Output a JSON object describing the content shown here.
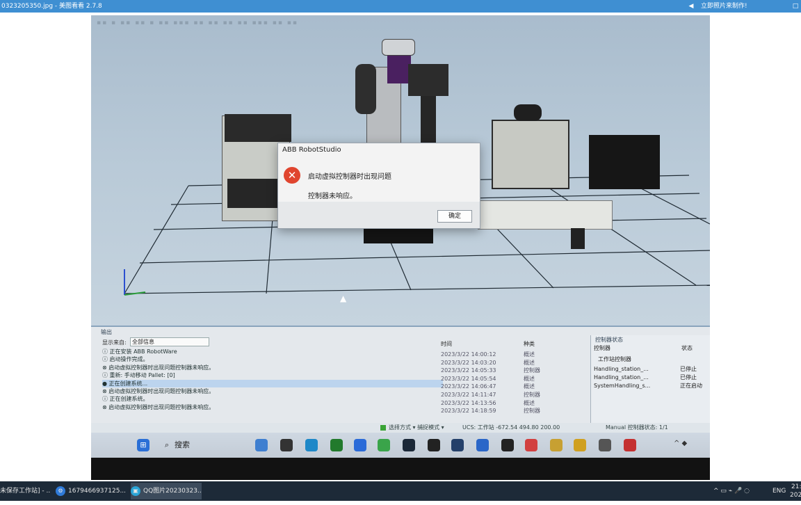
{
  "viewer": {
    "title": "0323205350.jpg - 美图看看 2.7.8",
    "speaker_icon": "speaker-icon",
    "promo": "立即照片来制作!",
    "maximize_label": "□"
  },
  "scene": {
    "toolbar_text": "▪▪ ▪ ▪▪ ▪▪ ▪ ▪▪ ▪▪▪ ▪▪ ▪▪ ▪▪ ▪▪ ▪▪▪ ▪▪ ▪▪"
  },
  "dialog": {
    "title": "ABB RobotStudio",
    "icon": "error-icon",
    "icon_glyph": "✕",
    "message": "启动虚拟控制器时出现问题",
    "detail": "控制器未响应。",
    "ok_label": "确定"
  },
  "output": {
    "tab_label": "输出",
    "filter_label": "显示来自:",
    "filter_value": "全部信息",
    "col_time": "时间",
    "col_category": "种类",
    "messages": [
      "ⓘ 正在安装 ABB RobotWare",
      "ⓘ 启动操作完成。",
      "⊗ 启动虚拟控制器时出现问题控制器未响应。",
      "ⓘ 重新: 手动移动 Pallet: [0]",
      "● 正在创建系统...",
      "⊗ 启动虚拟控制器时出现问题控制器未响应。",
      "ⓘ 正在创建系统。",
      "⊗ 启动虚拟控制器时出现问题控制器未响应。"
    ],
    "times": [
      "2023/3/22 14:00:12",
      "2023/3/22 14:03:20",
      "2023/3/22 14:05:33",
      "2023/3/22 14:05:54",
      "2023/3/22 14:06:47",
      "2023/3/22 14:11:47",
      "2023/3/22 14:13:56",
      "2023/3/22 14:18:59"
    ],
    "categories": [
      "概述",
      "概述",
      "控制器",
      "概述",
      "概述",
      "控制器",
      "概述",
      "控制器"
    ]
  },
  "controller_panel": {
    "header": "控制器状态",
    "col_controller": "控制器",
    "col_state": "状态",
    "group": "工作站控制器",
    "rows": [
      {
        "name": "Handling_station_...",
        "state": "已停止"
      },
      {
        "name": "Handling_station_...",
        "state": "已停止"
      },
      {
        "name": "SystemHandling_s...",
        "state": "正在启动"
      }
    ]
  },
  "status_bar": {
    "mode": "选择方式 ▾ 捕捉模式 ▾",
    "coords": "UCS: 工作站  -672.54  494.80  200.00",
    "right": "Manual  控制器状态: 1/1"
  },
  "photo_taskbar": {
    "search_label": "搜索",
    "search_icon": "search-icon",
    "tray": "^ ◆"
  },
  "taskbar": {
    "items": [
      {
        "label": "未保存工作站] - ...",
        "icon": "robotstudio-icon"
      },
      {
        "label": "1679466937125...",
        "icon": "settings-icon"
      },
      {
        "label": "QQ图片20230323...",
        "icon": "image-viewer-icon"
      }
    ],
    "tray_icons": "^ ▭ ⌁ 🎤 ◌",
    "lang": "ENG",
    "time": "21:",
    "date": "202"
  },
  "colors": {
    "viewer_titlebar": "#3f8fd2",
    "error": "#e0452f",
    "taskbar": "#1d2a38"
  }
}
